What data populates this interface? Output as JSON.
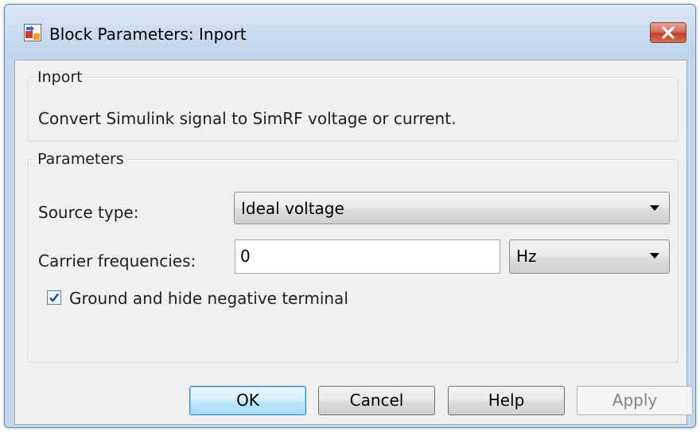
{
  "window": {
    "title": "Block Parameters: Inport",
    "icon": "simulink-block-icon",
    "close_icon": "close-icon"
  },
  "inport_group": {
    "title": "Inport",
    "description": "Convert Simulink signal to SimRF voltage or current."
  },
  "parameters_group": {
    "title": "Parameters",
    "source_type": {
      "label": "Source type:",
      "value": "Ideal voltage"
    },
    "carrier_frequencies": {
      "label": "Carrier frequencies:",
      "value": "0",
      "unit": "Hz"
    },
    "ground_checkbox": {
      "label": "Ground and hide negative terminal",
      "checked": true
    }
  },
  "buttons": {
    "ok": "OK",
    "cancel": "Cancel",
    "help": "Help",
    "apply": "Apply"
  },
  "colors": {
    "title_bar": "#c9dbef",
    "close_button": "#c75a46",
    "default_button": "#bee6fd",
    "dialog_background": "#f0f0f0"
  }
}
